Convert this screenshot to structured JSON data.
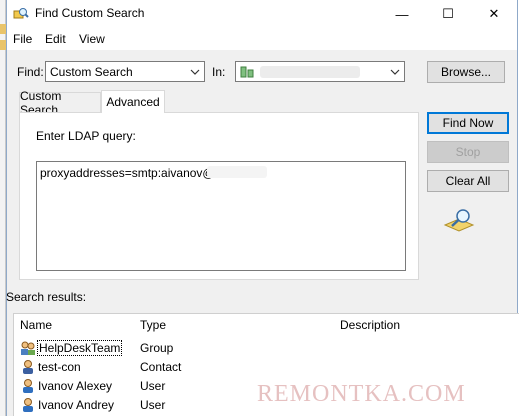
{
  "window": {
    "title": "Find Custom Search",
    "controls": {
      "minimize": "—",
      "maximize": "☐",
      "close": "✕"
    }
  },
  "menu": [
    "File",
    "Edit",
    "View"
  ],
  "find": {
    "label": "Find:",
    "value": "Custom Search"
  },
  "in": {
    "label": "In:",
    "value": ""
  },
  "buttons": {
    "browse": "Browse...",
    "find_now": "Find Now",
    "stop": "Stop",
    "clear_all": "Clear All"
  },
  "tabs": [
    "Custom Search",
    "Advanced"
  ],
  "ldap": {
    "label": "Enter LDAP query:",
    "query": "proxyaddresses=smtp:aivanov@c"
  },
  "results": {
    "label": "Search results:",
    "columns": [
      "Name",
      "Type",
      "Description"
    ],
    "rows": [
      {
        "name": "HelpDeskTeam",
        "type": "Group",
        "description": "",
        "icon": "group-icon"
      },
      {
        "name": "test-con",
        "type": "Contact",
        "description": "",
        "icon": "contact-icon"
      },
      {
        "name": "Ivanov Alexey",
        "type": "User",
        "description": "",
        "icon": "user-icon"
      },
      {
        "name": "Ivanov Andrey",
        "type": "User",
        "description": "",
        "icon": "user-icon"
      }
    ]
  },
  "watermark": "REMONTKA.COM",
  "colors": {
    "accent": "#0078d7",
    "disabled": "#a0a0a0"
  }
}
